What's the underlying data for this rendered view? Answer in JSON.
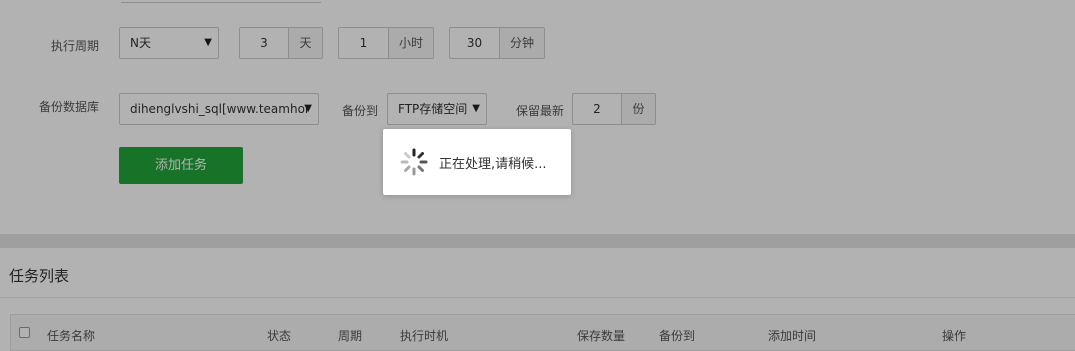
{
  "form": {
    "period": {
      "label": "执行周期",
      "type_value": "N天",
      "day": {
        "value": "3",
        "unit": "天"
      },
      "hour": {
        "value": "1",
        "unit": "小时"
      },
      "minute": {
        "value": "30",
        "unit": "分钟"
      }
    },
    "database": {
      "label": "备份数据库",
      "value": "dihenglvshi_sql[www.teamhor"
    },
    "backup_to": {
      "label": "备份到",
      "value": "FTP存储空间"
    },
    "keep": {
      "label": "保留最新",
      "value": "2",
      "unit": "份"
    },
    "add_button": "添加任务"
  },
  "task_list": {
    "title": "任务列表",
    "columns": [
      "任务名称",
      "状态",
      "周期",
      "执行时机",
      "保存数量",
      "备份到",
      "添加时间",
      "操作"
    ]
  },
  "loading": {
    "text": "正在处理,请稍候..."
  },
  "colors": {
    "accent_green": "#20a53a",
    "overlay": "rgba(0,0,0,0.3)"
  },
  "icons": {
    "select_caret": "caret-down-icon",
    "spinner": "loading-spinner-icon",
    "checkbox": "checkbox-icon"
  }
}
